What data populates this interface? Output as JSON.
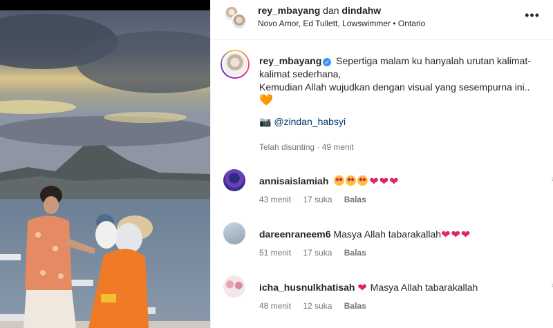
{
  "header": {
    "user1": "rey_mbayang",
    "conjunction": "dan",
    "user2": "dindahw",
    "subtitle": "Novo Amor, Ed Tullett, Lowswimmer • Ontario",
    "more_icon": "more-horizontal-icon"
  },
  "caption": {
    "username": "rey_mbayang",
    "text_line1": "Sepertiga malam ku hanyalah urutan kalimat-kalimat sederhana,",
    "text_line2": "Kemudian Allah wujudkan dengan visual yang sesempurna ini..",
    "heart": "🧡",
    "camera": "📷",
    "mention": "@zindan_habsyi",
    "meta": "Telah disunting · 49 menit"
  },
  "comments": [
    {
      "username": "annisaislamiah",
      "text": "",
      "emoji": "😍😍😍💘💘💘",
      "time": "43 menit",
      "likes": "17 suka",
      "reply": "Balas"
    },
    {
      "username": "dareenraneem6",
      "text": "Masya Allah tabarakallah",
      "emoji": "❤️❤️❤️",
      "time": "51 menit",
      "likes": "17 suka",
      "reply": "Balas"
    },
    {
      "username": "icha_husnulkhatisah",
      "prefix_emoji": "❤️",
      "text": "Masya Allah tabarakallah",
      "time": "48 menit",
      "likes": "12 suka",
      "reply": "Balas"
    }
  ],
  "colors": {
    "link": "#00376b",
    "meta": "#737373",
    "verified": "#3897f0",
    "heart_red": "#e0245e",
    "heart_orange": "#f26b1d"
  }
}
